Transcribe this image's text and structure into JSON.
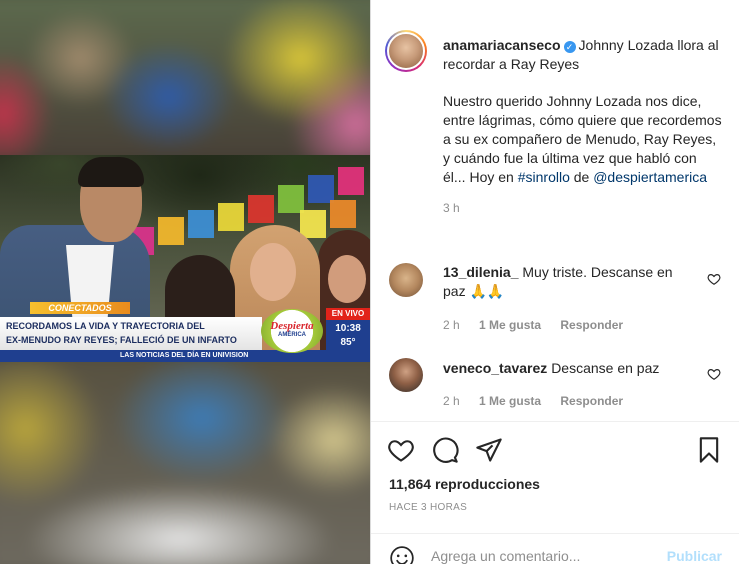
{
  "video": {
    "lower_third_tag": "CONECTADOS",
    "headline_line1": "RECORDAMOS LA VIDA Y TRAYECTORIA DEL",
    "headline_line2": "EX-MENUDO RAY REYES; FALLECIÓ DE UN INFARTO",
    "ticker": "LAS NOTICIAS DEL DÍA EN UNIVISION",
    "logo_line1": "Despierta",
    "logo_line2": "AMÉRICA",
    "live_label": "EN VIVO",
    "time": "10:38",
    "temperature": "85°"
  },
  "post": {
    "username": "anamariacanseco",
    "verified_icon": "verified-badge-icon",
    "title": "Johnny Lozada llora al recordar a Ray Reyes",
    "body": "Nuestro querido Johnny Lozada nos dice, entre lágrimas, cómo quiere que recordemos a su ex compañero de Menudo, Ray Reyes, y cuándo fue la última vez que habló con él... Hoy en",
    "hashtag": "#sinrollo",
    "connector": "de",
    "mention": "@despiertamerica",
    "time_ago": "3 h"
  },
  "comments": [
    {
      "username": "13_dilenia_",
      "text": "Muy triste. Descanse en paz",
      "emoji": "🙏🙏",
      "time": "2 h",
      "likes": "1 Me gusta",
      "reply": "Responder"
    },
    {
      "username": "veneco_tavarez",
      "text": "Descanse en paz",
      "time": "2 h",
      "likes": "1 Me gusta",
      "reply": "Responder"
    }
  ],
  "actions": {
    "views": "11,864 reproducciones",
    "posted_ago": "HACE 3 HORAS",
    "comment_placeholder": "Agrega un comentario...",
    "publish_label": "Publicar"
  },
  "colors": {
    "link": "#00376b",
    "publish_disabled": "#b2dffc",
    "verified": "#3897f0",
    "muted": "#8e8e8e"
  }
}
